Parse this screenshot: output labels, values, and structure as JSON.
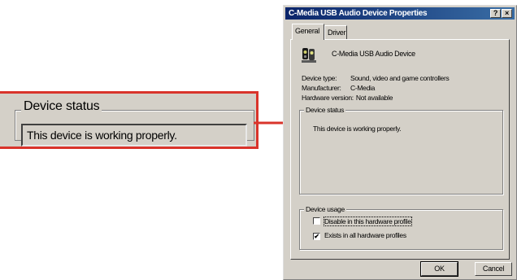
{
  "callout": {
    "group_title": "Device status",
    "status_text": "This device is working properly."
  },
  "dialog": {
    "title": "C-Media USB Audio Device Properties",
    "help_glyph": "?",
    "close_glyph": "×",
    "tabs": [
      {
        "label": "General",
        "selected": true
      },
      {
        "label": "Driver",
        "selected": false
      }
    ],
    "device_name": "C-Media USB Audio Device",
    "properties": [
      {
        "key": "Device type:",
        "value": "Sound, video and game controllers"
      },
      {
        "key": "Manufacturer:",
        "value": "C-Media"
      },
      {
        "key": "Hardware version:",
        "value": "Not available"
      }
    ],
    "status_group_label": "Device status",
    "status_text": "This device is working properly.",
    "usage_group_label": "Device usage",
    "usage_options": [
      {
        "label": "Disable in this hardware profile",
        "checked": false
      },
      {
        "label": "Exists in all hardware profiles",
        "checked": true
      }
    ],
    "check_glyph": "✔",
    "ok_label": "OK",
    "cancel_label": "Cancel"
  },
  "colors": {
    "accent_red": "#d9342b",
    "titlebar": "#0a246a",
    "dialog_face": "#d4d0c8"
  },
  "icons": [
    "speaker-device-icon",
    "arrow-icon"
  ]
}
